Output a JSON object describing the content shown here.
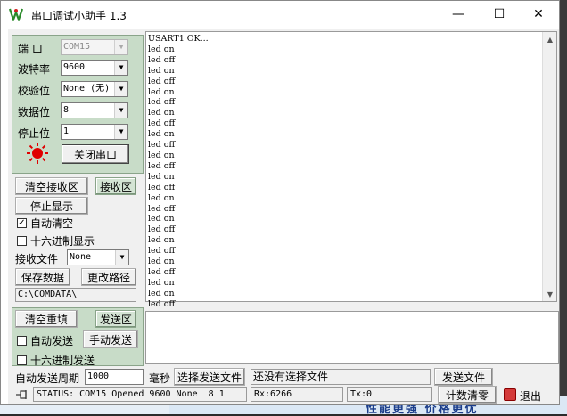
{
  "window": {
    "title": "串口调试小助手 1.3",
    "minimize_glyph": "—",
    "maximize_glyph": "☐",
    "close_glyph": "✕"
  },
  "settings": {
    "port_label": "端  口",
    "port_value": "COM15",
    "baud_label": "波特率",
    "baud_value": "9600",
    "parity_label": "校验位",
    "parity_value": "None (无)",
    "databits_label": "数据位",
    "databits_value": "8",
    "stopbits_label": "停止位",
    "stopbits_value": "1",
    "close_port_button": "关闭串口"
  },
  "receive": {
    "clear_button": "清空接收区",
    "area_label": "接收区",
    "stop_display_button": "停止显示",
    "auto_clear_label": "自动清空",
    "auto_clear_checked": true,
    "auto_clear_mark": "✓",
    "hex_display_label": "十六进制显示",
    "hex_display_checked": false,
    "recv_file_label": "接收文件",
    "recv_file_value": "None",
    "save_data_button": "保存数据",
    "change_path_button": "更改路径",
    "path": "C:\\COMDATA\\",
    "lines": [
      "USART1 OK...",
      "led on",
      "led off",
      "led on",
      "led off",
      "led on",
      "led off",
      "led on",
      "led off",
      "led on",
      "led off",
      "led on",
      "led off",
      "led on",
      "led off",
      "led on",
      "led off",
      "led on",
      "led off",
      "led on",
      "led off",
      "led on",
      "led off",
      "led on",
      "led on",
      "led off"
    ]
  },
  "send": {
    "clear_resend_button": "清空重填",
    "area_label": "发送区",
    "auto_send_label": "自动发送",
    "auto_send_checked": false,
    "manual_send_button": "手动发送",
    "hex_send_label": "十六进制发送",
    "hex_send_checked": false,
    "period_label": "自动发送周期",
    "period_value": "1000",
    "period_unit": "毫秒",
    "choose_file_button": "选择发送文件",
    "file_status": "还没有选择文件",
    "send_file_button": "发送文件"
  },
  "status": {
    "text": "STATUS: COM15 Opened 9600 None  8 1",
    "rx": "Rx:6266",
    "tx": "Tx:0",
    "clear_count_button": "计数清零",
    "exit_button": "退出"
  },
  "background": {
    "left_char": "自",
    "banner_text": "性能更强  价格更优"
  },
  "colors": {
    "panel_green": "#c8dcc8",
    "led_red": "#e00000"
  }
}
